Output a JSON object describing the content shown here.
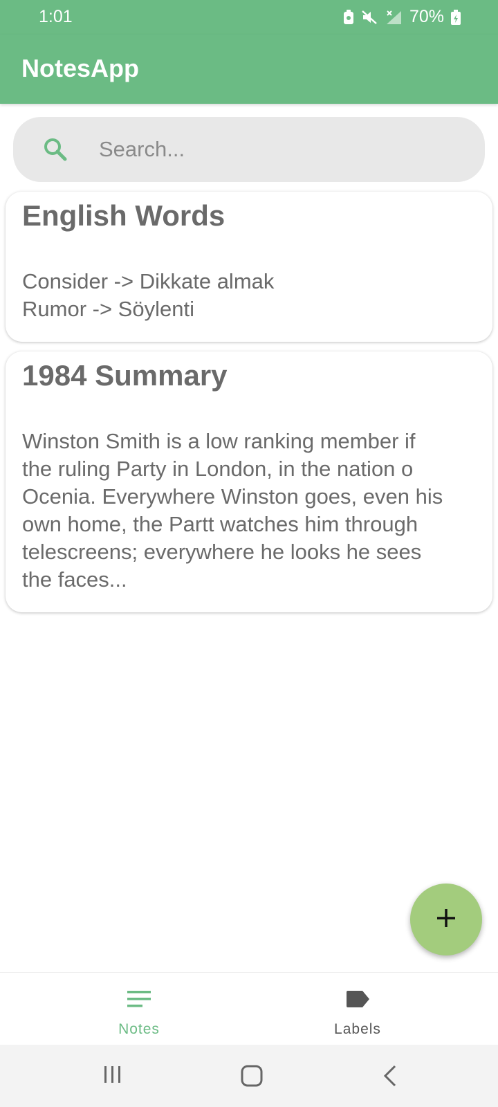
{
  "status_bar": {
    "time": "1:01",
    "battery": "70%"
  },
  "app_bar": {
    "title": "NotesApp"
  },
  "search": {
    "placeholder": "Search...",
    "value": ""
  },
  "notes": [
    {
      "title": "English Words",
      "body": "Consider -> Dikkate almak\nRumor -> Söylenti"
    },
    {
      "title": "1984 Summary",
      "body": "Winston Smith is a low ranking member if\nthe ruling Party in London, in the nation o\nOcenia. Everywhere Winston goes, even his\nown home, the Partt watches him through\ntelescreens; everywhere he looks he sees\nthe faces..."
    }
  ],
  "fab": {
    "icon": "plus-icon"
  },
  "bottom_nav": {
    "items": [
      {
        "label": "Notes",
        "icon": "notes-list-icon",
        "selected": true
      },
      {
        "label": "Labels",
        "icon": "label-tag-icon",
        "selected": false
      }
    ]
  },
  "colors": {
    "primary": "#6bbb84",
    "fab": "#a3cc7d",
    "search_bg": "#e8e8e8",
    "text_gray": "#6a6a6a"
  }
}
